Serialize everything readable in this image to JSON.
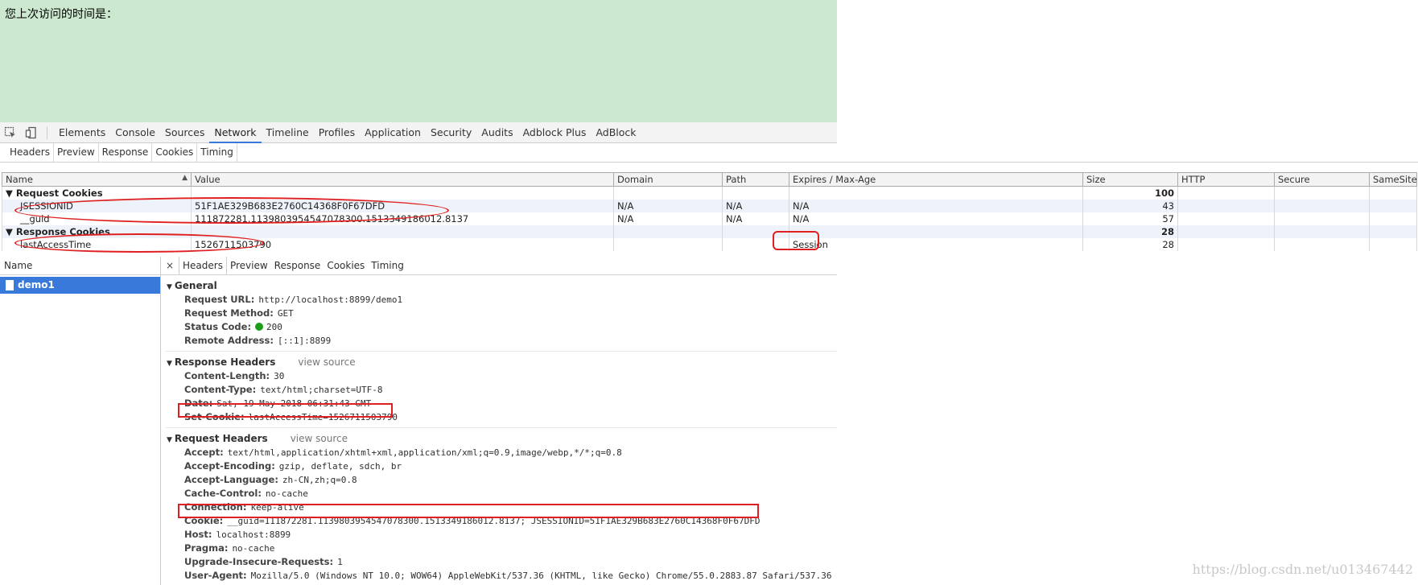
{
  "page": {
    "visit_text": "您上次访问的时间是："
  },
  "toolbar": {
    "tabs": [
      "Elements",
      "Console",
      "Sources",
      "Network",
      "Timeline",
      "Profiles",
      "Application",
      "Security",
      "Audits",
      "Adblock Plus",
      "AdBlock"
    ],
    "active_tab": "Network"
  },
  "cookie_tabs": {
    "tabs": [
      "Headers",
      "Preview",
      "Response",
      "Cookies",
      "Timing"
    ],
    "active": "Cookies"
  },
  "cookies_table": {
    "columns": [
      "Name",
      "Value",
      "Domain",
      "Path",
      "Expires / Max-Age",
      "Size",
      "HTTP",
      "Secure",
      "SameSite"
    ],
    "request_group": {
      "label": "Request Cookies",
      "size": "100"
    },
    "request_rows": [
      {
        "name": "JSESSIONID",
        "value": "51F1AE329B683E2760C14368F0F67DFD",
        "domain": "N/A",
        "path": "N/A",
        "expires": "N/A",
        "size": "43"
      },
      {
        "name": "__guid",
        "value": "111872281.1139803954547078300.1513349186012.8137",
        "domain": "N/A",
        "path": "N/A",
        "expires": "N/A",
        "size": "57"
      }
    ],
    "response_group": {
      "label": "Response Cookies",
      "size": "28"
    },
    "response_rows": [
      {
        "name": "lastAccessTime",
        "value": "1526711503790",
        "expires": "Session",
        "size": "28"
      }
    ]
  },
  "requests": {
    "header": "Name",
    "items": [
      "demo1"
    ]
  },
  "detail_tabs": {
    "close": "×",
    "tabs": [
      "Headers",
      "Preview",
      "Response",
      "Cookies",
      "Timing"
    ],
    "active": "Headers"
  },
  "general": {
    "title": "General",
    "request_url_key": "Request URL:",
    "request_url": "http://localhost:8899/demo1",
    "request_method_key": "Request Method:",
    "request_method": "GET",
    "status_code_key": "Status Code:",
    "status_code": "200",
    "remote_address_key": "Remote Address:",
    "remote_address": "[::1]:8899"
  },
  "response_headers": {
    "title": "Response Headers",
    "view_source": "view source",
    "content_length_key": "Content-Length:",
    "content_length": "30",
    "content_type_key": "Content-Type:",
    "content_type": "text/html;charset=UTF-8",
    "date_key": "Date:",
    "date": "Sat, 19 May 2018 06:31:43 GMT",
    "set_cookie_key": "Set-Cookie:",
    "set_cookie": "lastAccessTime=1526711503790"
  },
  "request_headers": {
    "title": "Request Headers",
    "view_source": "view source",
    "accept_key": "Accept:",
    "accept": "text/html,application/xhtml+xml,application/xml;q=0.9,image/webp,*/*;q=0.8",
    "accept_encoding_key": "Accept-Encoding:",
    "accept_encoding": "gzip, deflate, sdch, br",
    "accept_language_key": "Accept-Language:",
    "accept_language": "zh-CN,zh;q=0.8",
    "cache_control_key": "Cache-Control:",
    "cache_control": "no-cache",
    "connection_key": "Connection:",
    "connection": "keep-alive",
    "cookie_key": "Cookie:",
    "cookie": "__guid=111872281.1139803954547078300.1513349186012.8137; JSESSIONID=51F1AE329B683E2760C14368F0F67DFD",
    "host_key": "Host:",
    "host": "localhost:8899",
    "pragma_key": "Pragma:",
    "pragma": "no-cache",
    "upgrade_key": "Upgrade-Insecure-Requests:",
    "upgrade": "1",
    "user_agent_key": "User-Agent:",
    "user_agent": "Mozilla/5.0 (Windows NT 10.0; WOW64) AppleWebKit/537.36 (KHTML, like Gecko) Chrome/55.0.2883.87 Safari/537.36"
  },
  "watermark": "https://blog.csdn.net/u013467442",
  "colors": {
    "page_bg": "#cce8cf",
    "selection": "#3879d9",
    "highlight": "#e02020",
    "status_ok": "#1a9e1a"
  }
}
